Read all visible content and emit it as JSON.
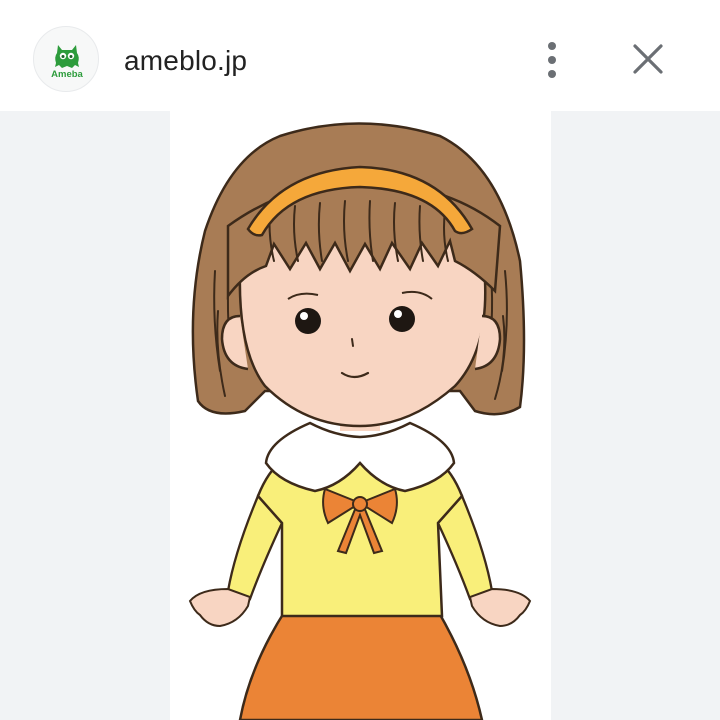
{
  "header": {
    "site_title": "ameblo.jp",
    "site_icon": {
      "name": "ameba-logo-icon",
      "label": "Ameba",
      "color": "#2d9c3c"
    },
    "menu_icon": "more-vert-icon",
    "close_icon": "close-icon"
  },
  "viewer": {
    "image": "girl-character-illustration",
    "background": "#f1f3f5"
  }
}
